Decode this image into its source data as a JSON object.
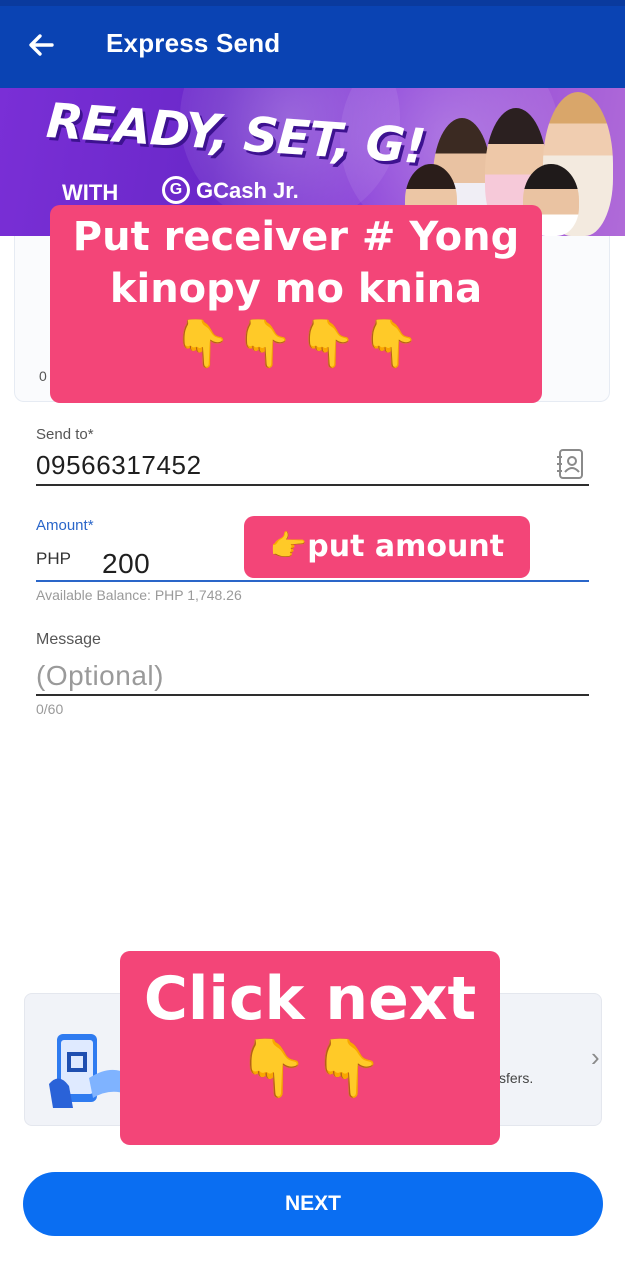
{
  "header": {
    "title": "Express Send",
    "back_icon": "arrow-left-icon"
  },
  "banner": {
    "headline": "READY, SET, G!",
    "with_text": "WITH",
    "logo_text": "G",
    "brand": "GCash Jr."
  },
  "card_top": {
    "partial_text": "0"
  },
  "overlays": {
    "receiver_line1": "Put receiver # Yong",
    "receiver_line2": "kinopy mo knina",
    "amount": "put amount",
    "next_line1": "Click next"
  },
  "form": {
    "send_to_label": "Send to*",
    "send_to_value": "09566317452",
    "amount_label": "Amount*",
    "currency": "PHP",
    "amount_value": "200",
    "available_balance": "Available Balance: PHP 1,748.26",
    "message_label": "Message",
    "message_placeholder": "(Optional)",
    "message_counter": "0/60"
  },
  "promo": {
    "partial_text": "sfers."
  },
  "actions": {
    "next_label": "NEXT"
  },
  "colors": {
    "header_bg": "#0a43b3",
    "overlay_pink": "#f34578",
    "amount_label": "#2a66c9",
    "next_button": "#0a6ef2"
  }
}
